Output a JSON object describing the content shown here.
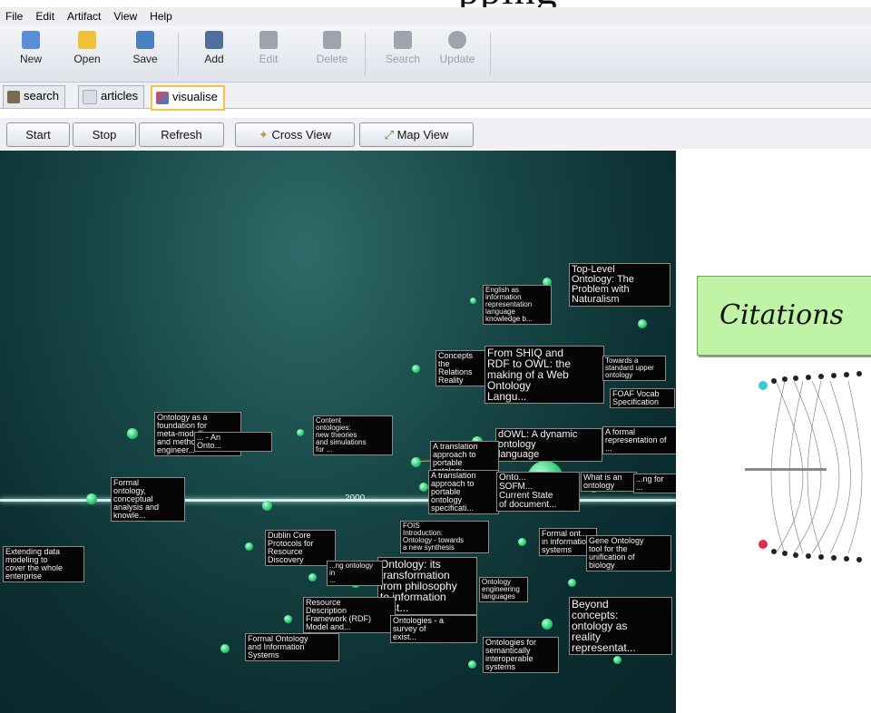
{
  "banner": {
    "title_fragment": "pping"
  },
  "menu": [
    "File",
    "Edit",
    "Artifact",
    "View",
    "Help"
  ],
  "toolbar": [
    {
      "label": "New",
      "icon": "new-document-icon",
      "color": "#5a8ed6",
      "disabled": false
    },
    {
      "label": "Open",
      "icon": "open-folder-icon",
      "color": "#f0c13a",
      "disabled": false
    },
    {
      "label": "Save",
      "icon": "save-disk-icon",
      "color": "#4b7fc0",
      "disabled": false
    },
    {
      "label": "Add",
      "icon": "add-document-icon",
      "color": "#4f6f9a",
      "disabled": false
    },
    {
      "label": "Edit",
      "icon": "edit-document-icon",
      "disabled": true
    },
    {
      "label": "Delete",
      "icon": "delete-document-icon",
      "disabled": true
    },
    {
      "label": "Search",
      "icon": "search-document-icon",
      "disabled": true
    },
    {
      "label": "Update",
      "icon": "refresh-icon",
      "disabled": true
    }
  ],
  "tabs": [
    {
      "label": "search",
      "icon": "search-tab-icon",
      "active": false
    },
    {
      "label": "articles",
      "icon": "articles-tab-icon",
      "active": false
    },
    {
      "label": "visualise",
      "icon": "visualise-tab-icon",
      "active": true
    }
  ],
  "actions": {
    "start": "Start",
    "stop": "Stop",
    "refresh": "Refresh",
    "cross_view": "Cross View",
    "map_view": "Map View"
  },
  "timeline": {
    "year": "2000"
  },
  "labels": [
    "Top-Level\nOntology: The\nProblem with\nNaturalism",
    "English as\ninformation\nrepresentation\nlanguage\nknowledge b...",
    "Concepts\nthe\nRelations\nReality",
    "From SHIQ and\nRDF to OWL: the\nmaking of a Web\nOntology\nLangu...",
    "Towards a\nstandard upper\nontology",
    "FOAF Vocab\nSpecification",
    "Ontology as a\nfoundation for\nmeta-modelling\nand method\nengineer...",
    "... - An\nOnto...",
    "Content\nontologies:\nnew theories\nand simulations\nfor ...",
    "dOWL: A dynamic\nontology\nlanguage",
    "A formal\nrepresentation of\n...",
    "A translation\napproach to\nportable\nontology",
    "A translation\napproach to\nportable\nontology\nspecificati...",
    "Onto...\nSOFM...\nCurrent State\nof document...",
    "What is an\nontology",
    "...ng for\n...",
    "Formal\nontology,\nconceptual\nanalysis and\nknowle...",
    "Dublin Core\nProtocols for\nResource\nDiscovery",
    "FOIS\nIntroduction:\nOntology - towards\na new synthesis",
    "Formal ont...\nin information\nsystems",
    "Gene Ontology\ntool for the\nunification of\nbiology",
    "Extending data\nmodeling to\ncover the whole\nenterprise",
    "Ontology: its\ntransformation\nfrom philosophy\nto information\nsyst...",
    "Ontology\nengineering\nlanguages",
    "...ng ontology\nin\n...",
    "Resource\nDescription\nFramework (RDF)\nModel and...",
    "Ontologies - a\nsurvey of\nexist...",
    "Beyond\nconcepts:\nontology as\nreality\nrepresentat...",
    "Formal Ontology\nand Information\nSystems",
    "Ontologies for\nsemantically\ninteroperable\nsystems"
  ],
  "citations": {
    "title": "Citations"
  }
}
